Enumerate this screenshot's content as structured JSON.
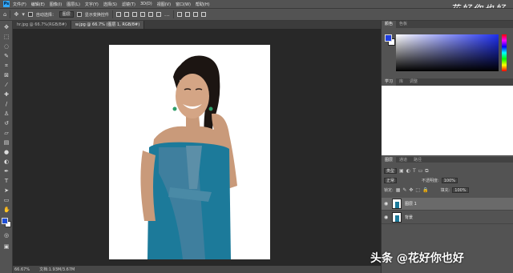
{
  "app": {
    "logo": "Ps"
  },
  "menubar": {
    "items": [
      "文件(F)",
      "编辑(E)",
      "图像(I)",
      "图层(L)",
      "文字(Y)",
      "选择(S)",
      "滤镜(T)",
      "3D(D)",
      "视图(V)",
      "窗口(W)",
      "帮助(H)"
    ]
  },
  "watermark_top": "花好你也好",
  "options": {
    "auto_select_label": "自动选择：",
    "auto_select_value": "图层",
    "show_transform_label": "显示变换控件"
  },
  "tabs": [
    {
      "label": "hr.jpg @ 66.7%(RGB/8#)",
      "active": false
    },
    {
      "label": "w.jpg @ 66.7% (图层 1, RGB/8#)",
      "active": true
    }
  ],
  "statusbar": {
    "zoom": "66.67%",
    "doc_info": "文档:1.93M/3.67M"
  },
  "panels": {
    "color_tabs": [
      "颜色",
      "色板"
    ],
    "learn_tabs": [
      "学习",
      "库",
      "调整"
    ],
    "layers_tabs": [
      "图层",
      "通道",
      "路径"
    ],
    "kind_value": "类型",
    "blend_mode": "正常",
    "opacity_label": "不透明度:",
    "opacity_value": "100%",
    "lock_label": "锁定:",
    "fill_label": "填充:",
    "fill_value": "100%",
    "layers": [
      {
        "name": "图层 1",
        "selected": true
      },
      {
        "name": "背景",
        "selected": false
      }
    ]
  },
  "watermark_bottom": "头条 @花好你也好",
  "colors": {
    "foreground": "#1f3fe0",
    "background": "#ffffff",
    "dress": "#1c7a9a"
  },
  "icons": {
    "tools": [
      "move-icon",
      "marquee-icon",
      "lasso-icon",
      "quick-select-icon",
      "crop-icon",
      "frame-icon",
      "eyedropper-icon",
      "healing-icon",
      "brush-icon",
      "stamp-icon",
      "history-brush-icon",
      "eraser-icon",
      "gradient-icon",
      "blur-icon",
      "dodge-icon",
      "pen-icon",
      "type-icon",
      "path-select-icon",
      "shape-icon",
      "hand-icon",
      "zoom-icon"
    ]
  }
}
